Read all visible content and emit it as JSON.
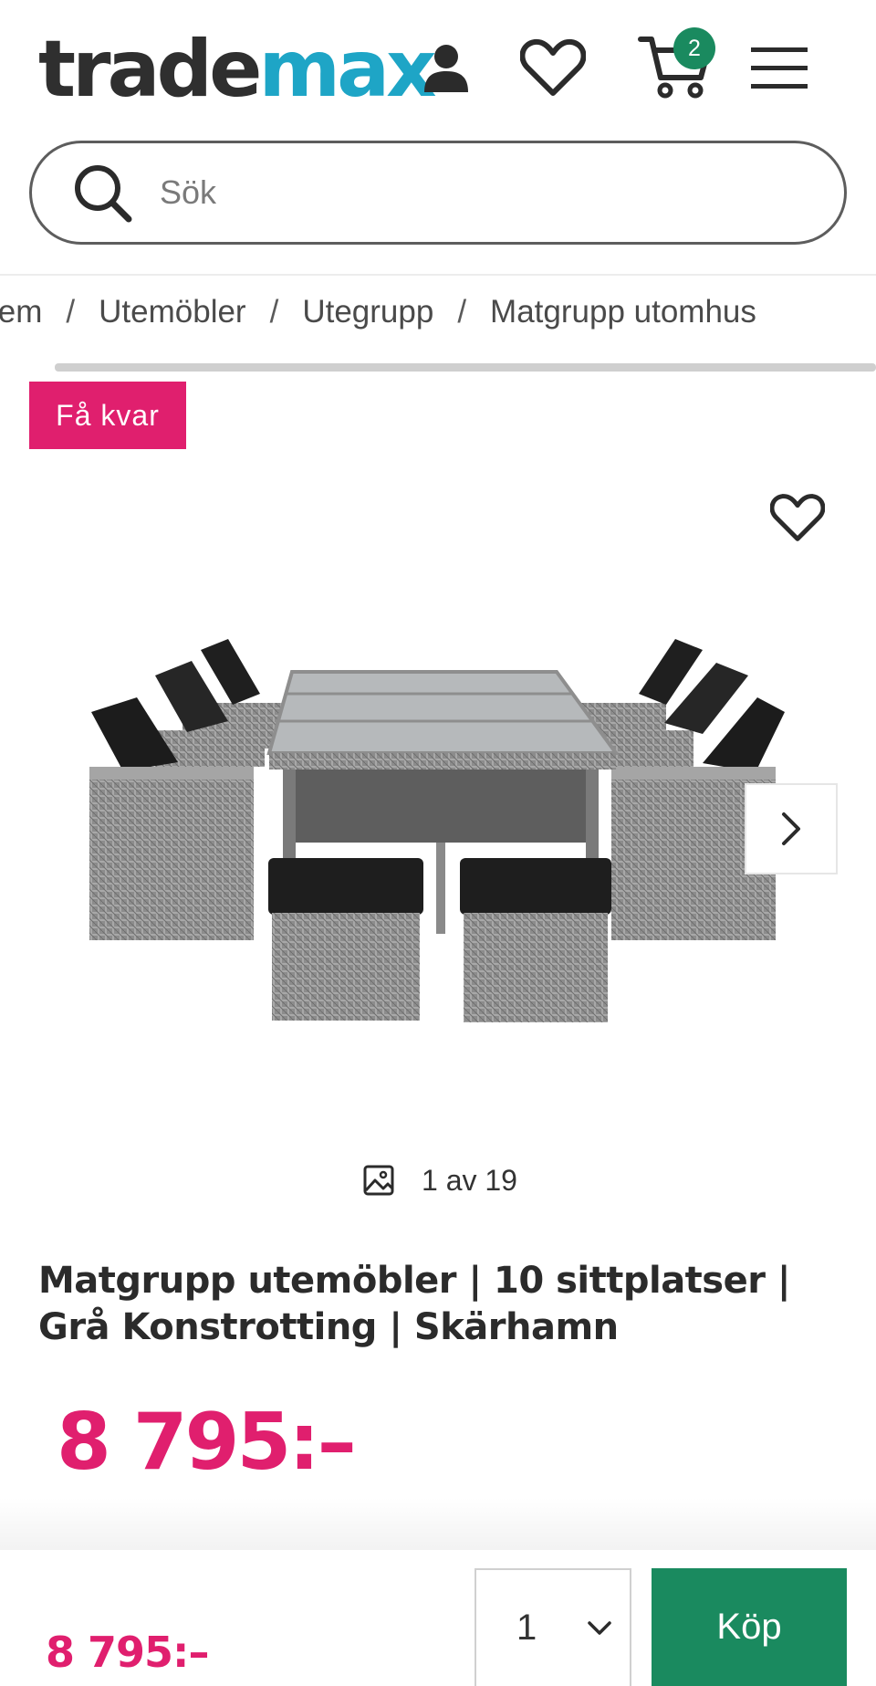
{
  "header": {
    "logo_part1": "trade",
    "logo_part2": "max",
    "cart_count": "2",
    "brand_color": "#1ea5c6",
    "icons": [
      "user-icon",
      "heart-icon",
      "cart-icon",
      "menu-icon"
    ]
  },
  "search": {
    "placeholder": "Sök",
    "value": ""
  },
  "breadcrumb": {
    "items": [
      "Hem",
      "Utemöbler",
      "Utegrupp",
      "Matgrupp utomhus"
    ],
    "visible_first": "lem",
    "separator": "/"
  },
  "badge": {
    "label": "Få kvar",
    "color": "#e01f6e"
  },
  "gallery": {
    "counter": "1 av 19"
  },
  "product": {
    "title": "Matgrupp utemöbler | 10 sittplatser | Grå Konstrotting | Skärhamn",
    "price": "8 795:–",
    "price_color": "#e01f6e"
  },
  "bottom_bar": {
    "price": "8 795:–",
    "quantity": "1",
    "buy_label": "Köp",
    "buy_color": "#1a8a5f"
  }
}
